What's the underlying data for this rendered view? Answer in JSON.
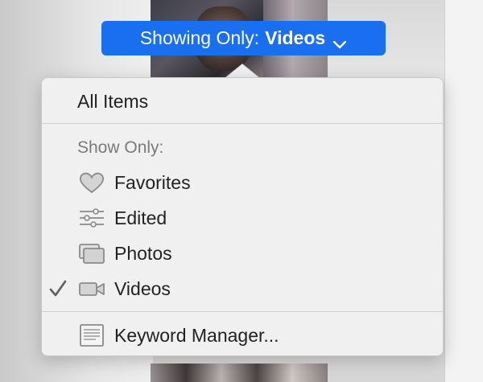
{
  "filter_button": {
    "prefix": "Showing Only:",
    "value": "Videos"
  },
  "menu": {
    "all_items": "All Items",
    "section_header": "Show Only:",
    "options": [
      {
        "label": "Favorites",
        "icon": "heart-icon",
        "checked": false
      },
      {
        "label": "Edited",
        "icon": "sliders-icon",
        "checked": false
      },
      {
        "label": "Photos",
        "icon": "photos-icon",
        "checked": false
      },
      {
        "label": "Videos",
        "icon": "video-camera-icon",
        "checked": true
      }
    ],
    "keyword_manager": "Keyword Manager..."
  },
  "colors": {
    "accent": "#1a6ff0",
    "menu_bg": "#f0f0f0",
    "text": "#222222",
    "header_text": "#7a7a7a",
    "icon": "#8a8a8a"
  }
}
